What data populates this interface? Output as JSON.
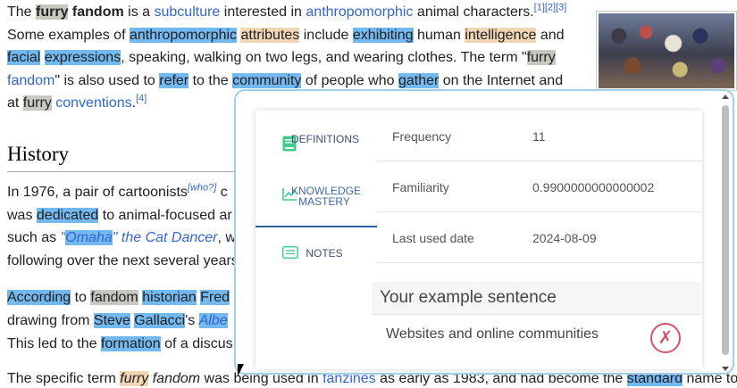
{
  "article": {
    "lines": [
      [
        "The ",
        "furry",
        " ",
        "fandom",
        " is a ",
        "subculture",
        " interested in ",
        "anthropomorphic",
        " animal characters."
      ],
      [
        "Some examples of ",
        "anthropomorphic",
        " ",
        "attributes",
        " include ",
        "exhibiting",
        " human ",
        "intelligence",
        " and"
      ],
      [
        "facial",
        " ",
        "expressions",
        ", speaking, walking on two legs, and wearing clothes. The term \"",
        "furry"
      ],
      [
        "fandom",
        "\" is also used to ",
        "refer",
        " to the ",
        "community",
        " of people who ",
        "gather",
        " on the Internet and"
      ],
      [
        "at ",
        "furry",
        " ",
        "conventions",
        "."
      ]
    ],
    "refs1": "[1][2][3]",
    "ref4": "[4]",
    "heading": "History",
    "p2": [
      [
        "In 1976, a pair of cartoonists",
        "[who?]",
        " c"
      ],
      [
        "was ",
        "dedicated",
        " to animal-focused ar"
      ],
      [
        "such as ",
        "\"",
        "Omaha",
        "\" the Cat Dancer",
        ", w"
      ],
      [
        "following over the next several years"
      ]
    ],
    "p3": [
      [
        "According",
        " to ",
        "fandom",
        " ",
        "historian",
        " ",
        "Fred"
      ],
      [
        "drawing from ",
        "Steve",
        " ",
        "Gallacci",
        "'s ",
        "Albe"
      ],
      [
        "This led to the ",
        "formation",
        " of a discus"
      ]
    ],
    "p4": [
      "The specific term ",
      "furry",
      " ",
      "fandom",
      " was being used in ",
      "fanzines",
      " as early as 1983, and had become the ",
      "standard",
      " name to"
    ]
  },
  "popup": {
    "tabs": [
      {
        "label": "DEFINITIONS",
        "icon": "book-icon"
      },
      {
        "label": "KNOWLEDGE MASTERY",
        "icon": "trend-chart-icon"
      },
      {
        "label": "NOTES",
        "icon": "notes-icon"
      }
    ],
    "active_tab": "KNOWLEDGE MASTERY",
    "stats": [
      {
        "label": "Frequency",
        "value": "11"
      },
      {
        "label": "Familiarity",
        "value": "0.9900000000000002"
      },
      {
        "label": "Last used date",
        "value": "2024-08-09"
      }
    ],
    "example_title": "Your example sentence",
    "example_sentence": "Websites and online communities",
    "close_symbol": "✗"
  },
  "colors": {
    "highlight_blue": "#74b8f0",
    "highlight_gray": "#c8c8c0",
    "highlight_tan": "#f2d5b5",
    "link": "#3366cc",
    "popup_border": "#9fd0e8",
    "close": "#d3556a"
  }
}
